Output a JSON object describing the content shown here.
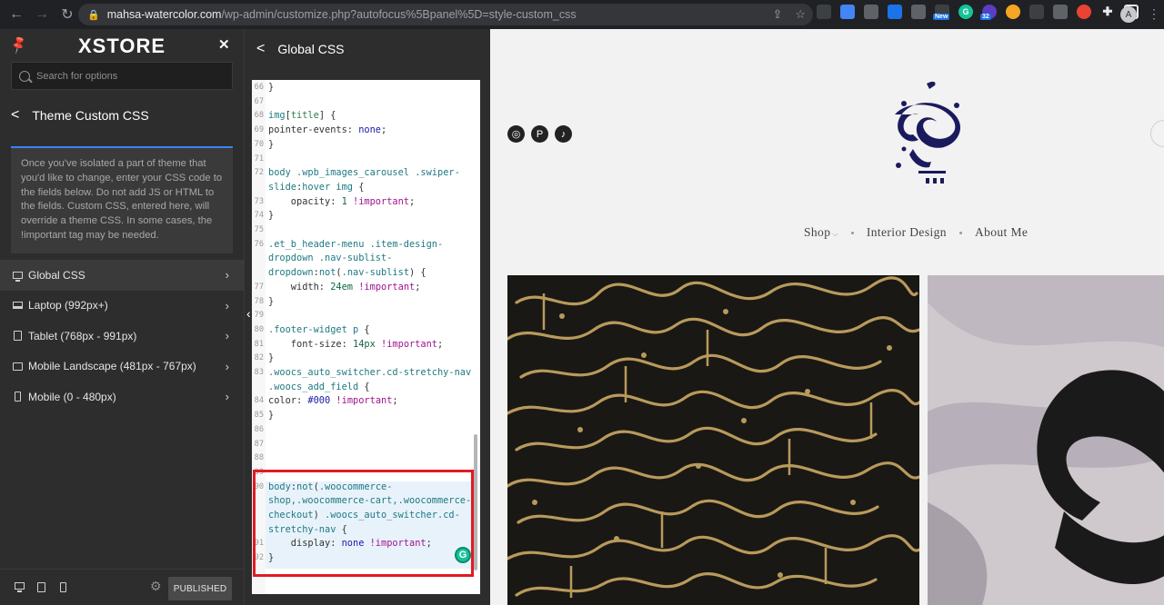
{
  "browser": {
    "url_host": "mahsa-watercolor.com",
    "url_path": "/wp-admin/customize.php?autofocus%5Bpanel%5D=style-custom_css",
    "profile_initial": "A",
    "ext_badge_new": "New",
    "ext_badge_count": "32"
  },
  "sidebar": {
    "logo": "XSTORE",
    "search_placeholder": "Search for options",
    "section_title": "Theme Custom CSS",
    "info_text": "Once you've isolated a part of theme that you'd like to change, enter your CSS code to the fields below. Do not add JS or HTML to the fields. Custom CSS, entered here, will override a theme CSS. In some cases, the !important tag may be needed.",
    "items": [
      {
        "label": "Global CSS",
        "icon": "monitor-icon"
      },
      {
        "label": "Laptop (992px+)",
        "icon": "laptop-icon"
      },
      {
        "label": "Tablet (768px - 991px)",
        "icon": "tablet-icon"
      },
      {
        "label": "Mobile Landscape (481px - 767px)",
        "icon": "landscape-icon"
      },
      {
        "label": "Mobile (0 - 480px)",
        "icon": "phone-icon"
      }
    ],
    "publish_label": "PUBLISHED"
  },
  "editor": {
    "title": "Global CSS",
    "lines": [
      {
        "n": "66",
        "html": "}"
      },
      {
        "n": "67",
        "html": ""
      },
      {
        "n": "68",
        "html": "<span class='k-tag'>img</span>[<span class='k-attr'>title</span>] {"
      },
      {
        "n": "69",
        "html": "pointer-events: <span class='k-val'>none</span>;"
      },
      {
        "n": "70",
        "html": "}"
      },
      {
        "n": "71",
        "html": ""
      },
      {
        "n": "72",
        "html": "<span class='k-tag'>body</span> <span class='k-sel'>.wpb_images_carousel .swiper-</span>"
      },
      {
        "n": "",
        "html": "<span class='k-sel'>slide</span>:<span class='k-sel'>hover</span> <span class='k-tag'>img</span> {"
      },
      {
        "n": "73",
        "html": "    opacity: <span class='k-num'>1</span> <span class='k-imp'>!important</span>;"
      },
      {
        "n": "74",
        "html": "}"
      },
      {
        "n": "75",
        "html": ""
      },
      {
        "n": "76",
        "html": "<span class='k-sel'>.et_b_header-menu .item-design-</span>"
      },
      {
        "n": "",
        "html": "<span class='k-sel'>dropdown .nav-sublist-</span>"
      },
      {
        "n": "",
        "html": "<span class='k-sel'>dropdown</span>:<span class='k-sel'>not</span>(<span class='k-sel'>.nav-sublist</span>) {"
      },
      {
        "n": "77",
        "html": "    width: <span class='k-num'>24em</span> <span class='k-imp'>!important</span>;"
      },
      {
        "n": "78",
        "html": "}"
      },
      {
        "n": "79",
        "html": ""
      },
      {
        "n": "80",
        "html": "<span class='k-sel'>.footer-widget</span> <span class='k-tag'>p</span> {"
      },
      {
        "n": "81",
        "html": "    font-size: <span class='k-num'>14px</span> <span class='k-imp'>!important</span>;"
      },
      {
        "n": "82",
        "html": "}"
      },
      {
        "n": "83",
        "html": "<span class='k-sel'>.woocs_auto_switcher.cd-stretchy-nav</span>"
      },
      {
        "n": "",
        "html": "<span class='k-sel'>.woocs_add_field</span> {"
      },
      {
        "n": "84",
        "html": "color: <span class='k-col'>#000</span> <span class='k-imp'>!important</span>;"
      },
      {
        "n": "85",
        "html": "}"
      },
      {
        "n": "86",
        "html": ""
      },
      {
        "n": "87",
        "html": ""
      },
      {
        "n": "88",
        "html": ""
      },
      {
        "n": "89",
        "html": ""
      },
      {
        "n": "90",
        "html": "<span class='k-tag'>body</span>:<span class='k-sel'>not</span>(<span class='k-sel'>.woocommerce-</span>"
      },
      {
        "n": "",
        "html": "<span class='k-sel'>shop,.woocommerce-cart,.woocommerce-</span>"
      },
      {
        "n": "",
        "html": "<span class='k-sel'>checkout</span>) <span class='k-sel'>.woocs_auto_switcher.cd-</span>"
      },
      {
        "n": "",
        "html": "<span class='k-sel'>stretchy-nav</span> {"
      },
      {
        "n": "91",
        "html": "    display: <span class='k-val'>none</span> <span class='k-imp'>!important</span>;"
      },
      {
        "n": "92",
        "html": "}"
      }
    ]
  },
  "site": {
    "nav": [
      "Shop",
      "Interior Design",
      "About Me"
    ],
    "social": [
      "instagram-icon",
      "pinterest-icon",
      "tiktok-icon"
    ]
  },
  "colors": {
    "accent": "#3b82f6",
    "highlight": "#e01b24",
    "panel": "#2d2d2d"
  }
}
